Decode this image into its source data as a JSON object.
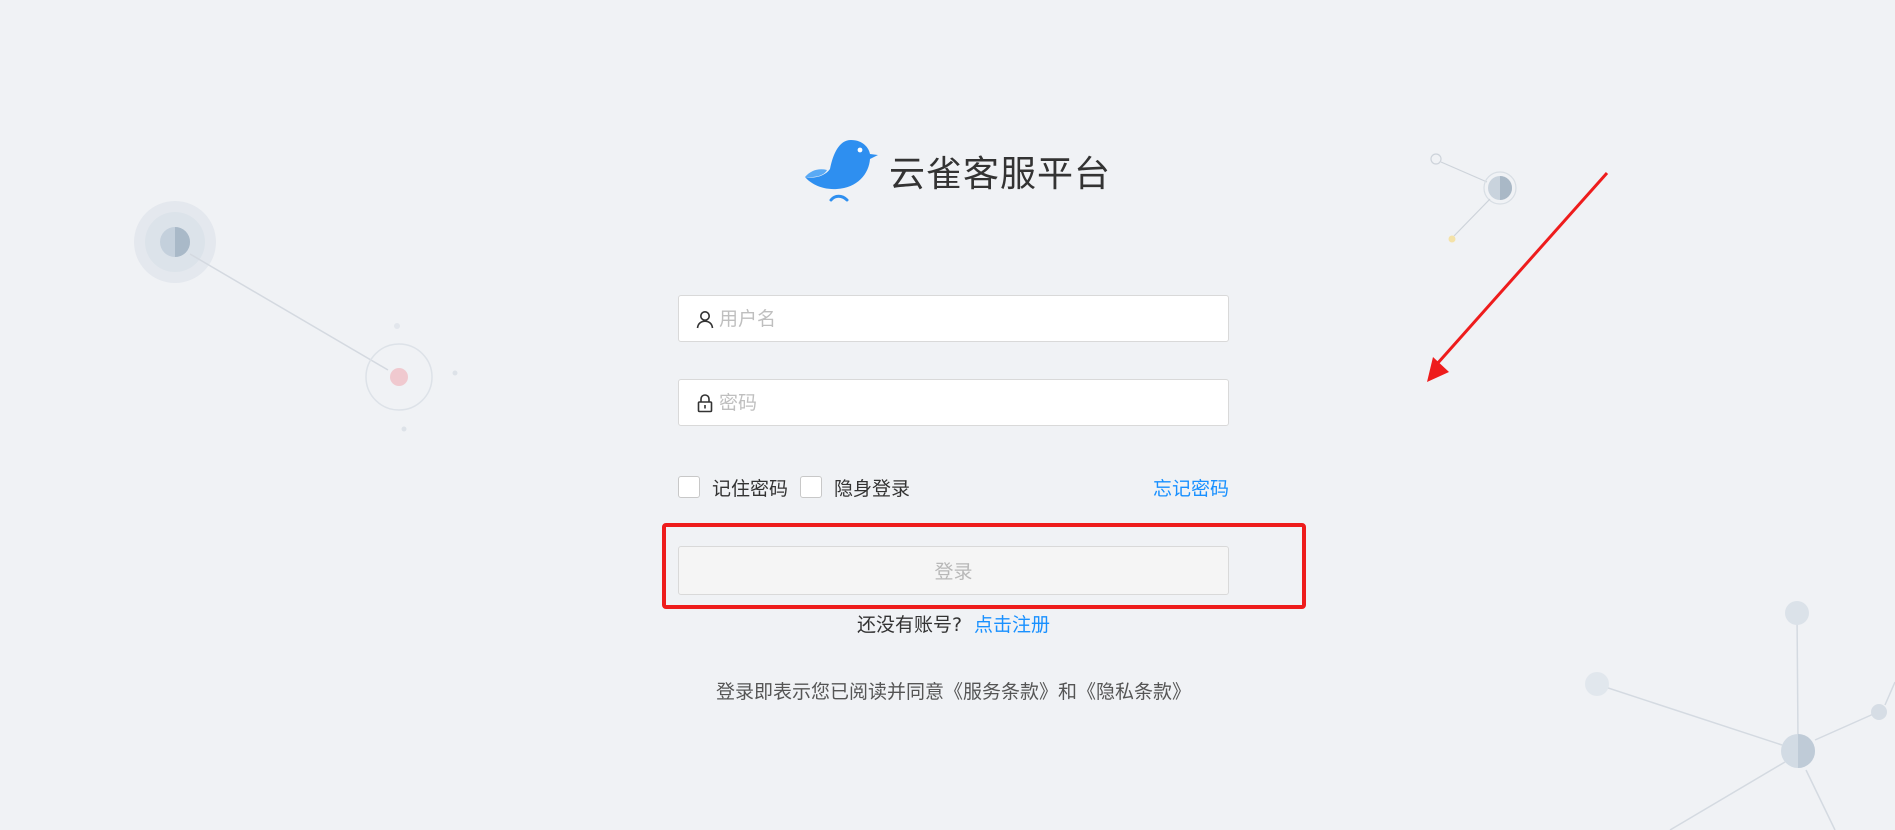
{
  "brand": {
    "title": "云雀客服平台",
    "logo_icon": "bird-logo-icon",
    "color": "#2e8ff0"
  },
  "form": {
    "username_placeholder": "用户名",
    "username_icon": "user-icon",
    "password_placeholder": "密码",
    "password_icon": "lock-icon",
    "remember_label": "记住密码",
    "invisible_label": "隐身登录",
    "forgot_link": "忘记密码",
    "login_button": "登录"
  },
  "register": {
    "prompt": "还没有账号?",
    "link": "点击注册"
  },
  "terms": {
    "prefix": "登录即表示您已阅读并同意",
    "service_link": "《服务条款》",
    "joiner": "和",
    "privacy_link": "《隐私条款》"
  },
  "theme": {
    "background": "#f0f2f5",
    "accent": "#1890ff",
    "annotation": "#ee1c1c"
  }
}
